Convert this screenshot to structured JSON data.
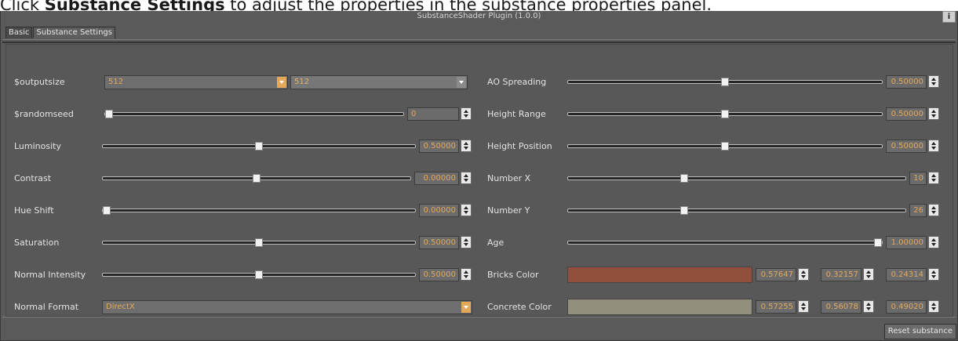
{
  "caption": {
    "prefix": "Click ",
    "bold": "Substance Settings",
    "suffix": " to adjust the properties in the substance properties panel."
  },
  "window": {
    "title": "SubstanceShader Plugin (1.0.0)",
    "info_label": "i"
  },
  "tabs": [
    "Basic",
    "Substance Settings"
  ],
  "left": {
    "outputsize": {
      "label": "$outputsize",
      "value1": "512",
      "value2": "512"
    },
    "randomseed": {
      "label": "$randomseed",
      "value": "0",
      "level": 0
    },
    "luminosity": {
      "label": "Luminosity",
      "value": "0.50000",
      "level": 0.5
    },
    "contrast": {
      "label": "Contrast",
      "value": "0.00000",
      "level": 0.5
    },
    "hue_shift": {
      "label": "Hue Shift",
      "value": "0.00000",
      "level": 0
    },
    "saturation": {
      "label": "Saturation",
      "value": "0.50000",
      "level": 0.5
    },
    "normal_intensity": {
      "label": "Normal Intensity",
      "value": "0.50000",
      "level": 0.5
    },
    "normal_format": {
      "label": "Normal Format",
      "value": "DirectX"
    }
  },
  "right": {
    "ao_spreading": {
      "label": "AO Spreading",
      "value": "0.50000",
      "level": 0.5
    },
    "height_range": {
      "label": "Height Range",
      "value": "0.50000",
      "level": 0.5
    },
    "height_position": {
      "label": "Height Position",
      "value": "0.50000",
      "level": 0.5
    },
    "number_x": {
      "label": "Number X",
      "value": "10",
      "level": 0.34
    },
    "number_y": {
      "label": "Number Y",
      "value": "26",
      "level": 0.34
    },
    "age": {
      "label": "Age",
      "value": "1.00000",
      "level": 1.0
    },
    "bricks_color": {
      "label": "Bricks Color",
      "r": "0.57647",
      "g": "0.32157",
      "b": "0.24314",
      "color": "#934f3d"
    },
    "concrete_color": {
      "label": "Concrete Color",
      "r": "0.57255",
      "g": "0.56078",
      "b": "0.49020",
      "color": "#928f7d"
    }
  },
  "reset_label": "Reset substance",
  "colors": {
    "accent": "#e4a85a",
    "panel": "#5a5a5a"
  }
}
